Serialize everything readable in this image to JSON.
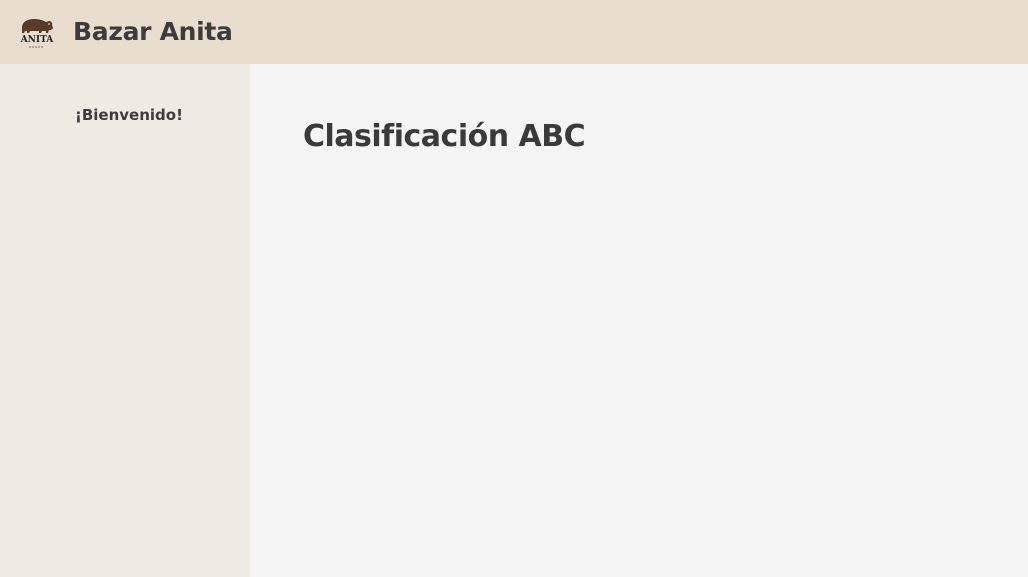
{
  "header": {
    "logo_text": "ANITA",
    "logo_icon": "bear-logo-icon",
    "app_title": "Bazar Anita"
  },
  "sidebar": {
    "welcome": "¡Bienvenido!"
  },
  "main": {
    "title": "Clasificación ABC"
  },
  "colors": {
    "header_bg": "#e9dece",
    "sidebar_bg": "#f0ece4",
    "main_bg": "#f5f5f5",
    "text": "#3a3a3a",
    "logo_bear": "#5a3a24"
  }
}
